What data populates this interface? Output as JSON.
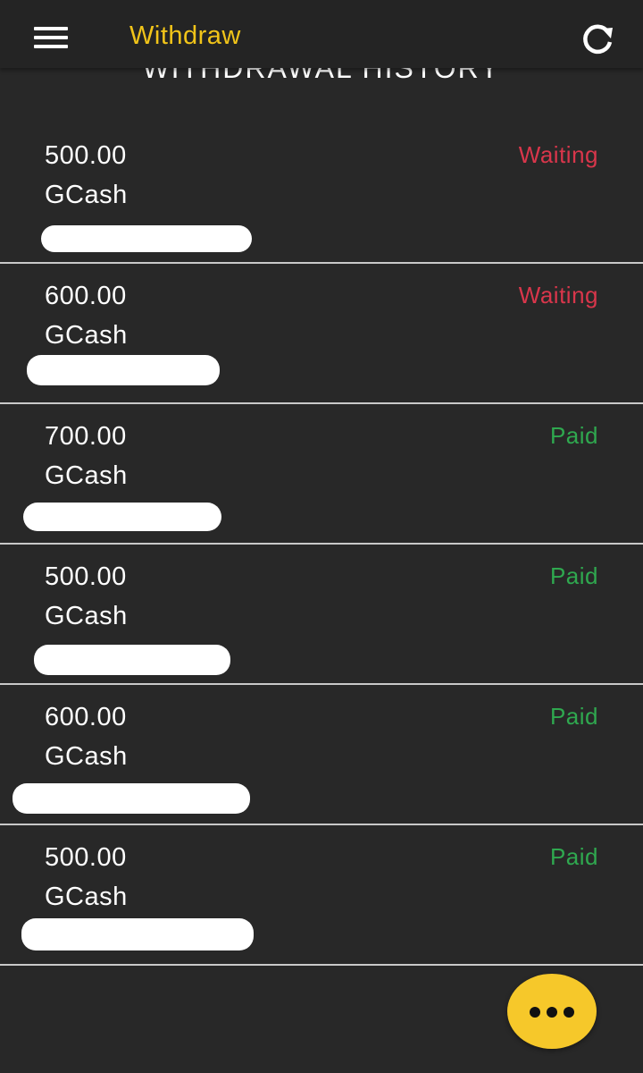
{
  "appbar": {
    "title": "Withdraw",
    "menu_icon": "hamburger-menu-icon",
    "refresh_icon": "refresh-icon",
    "title_color": "#f1c419"
  },
  "section": {
    "heading": "WITHDRAWAL HISTORY"
  },
  "history": [
    {
      "amount": "500.00",
      "method": "GCash",
      "status": "Waiting"
    },
    {
      "amount": "600.00",
      "method": "GCash",
      "status": "Waiting"
    },
    {
      "amount": "700.00",
      "method": "GCash",
      "status": "Paid"
    },
    {
      "amount": "500.00",
      "method": "GCash",
      "status": "Paid"
    },
    {
      "amount": "600.00",
      "method": "GCash",
      "status": "Paid"
    },
    {
      "amount": "500.00",
      "method": "GCash",
      "status": "Paid"
    }
  ],
  "status_colors": {
    "waiting": "#d9364b",
    "paid": "#2fa84f"
  },
  "fab": {
    "icon": "more-horizontal-icon",
    "color": "#f6c82a"
  }
}
